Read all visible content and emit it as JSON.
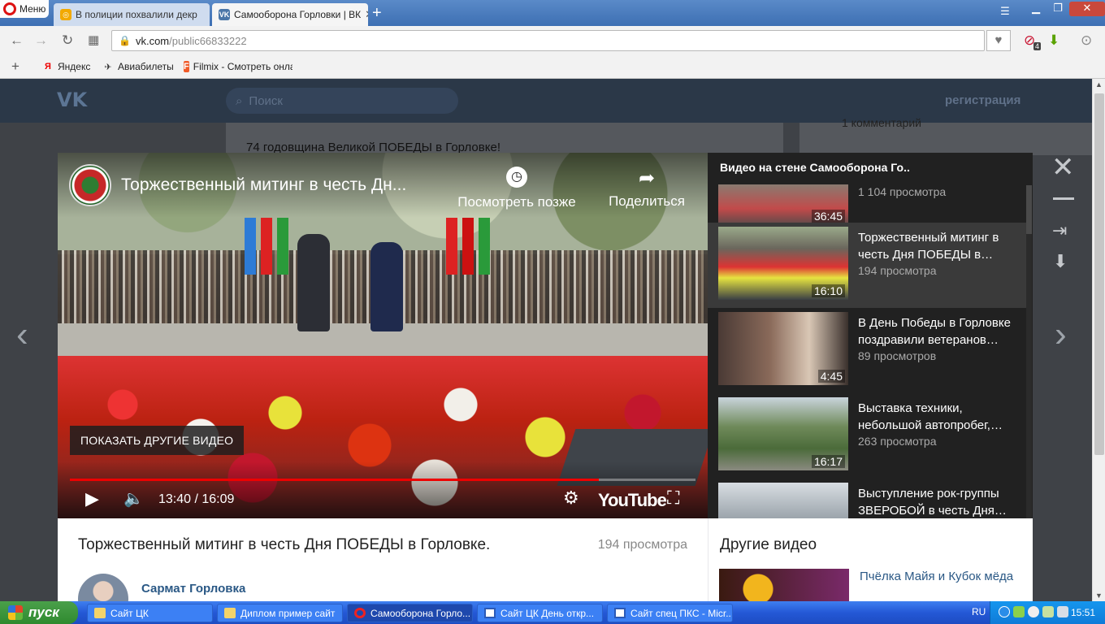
{
  "browser": {
    "menu_label": "Меню",
    "tabs": [
      {
        "title": "В полиции похвалили декр",
        "active": false
      },
      {
        "title": "Самооборона Горловки | ВК",
        "active": true
      }
    ],
    "new_tab_label": "+",
    "url_host": "vk.com",
    "url_path": "/public66833222",
    "bookmarks": [
      {
        "label": "Яндекс",
        "icon": "yandex-icon"
      },
      {
        "label": "Авиабилеты",
        "icon": "plane-icon"
      },
      {
        "label": "Filmix - Смотреть онлай",
        "icon": "filmix-icon"
      }
    ],
    "badge_count": "4"
  },
  "vk": {
    "logo": "VK",
    "search_placeholder": "Поиск",
    "register_label": "регистрация",
    "bg_post_text": "74 годовщина Великой ПОБЕДЫ в Горловке!",
    "bg_side_text": "1 комментарий"
  },
  "player": {
    "title": "Торжественный митинг в честь Дн...",
    "watch_later": "Посмотреть позже",
    "share": "Поделиться",
    "show_more": "ПОКАЗАТЬ ДРУГИЕ ВИДЕО",
    "time": "13:40 / 16:09",
    "progress_fraction": 0.846,
    "youtube_label": "YouTube"
  },
  "playlist": {
    "heading": "Видео на стене Самооборона Го..",
    "items": [
      {
        "title": "",
        "views": "1 104 просмотра",
        "duration": "36:45",
        "current": false
      },
      {
        "title": "Торжественный митинг в честь Дня ПОБЕДЫ в…",
        "views": "194 просмотра",
        "duration": "16:10",
        "current": true
      },
      {
        "title": "В День Победы в Горловке поздравили ветеранов…",
        "views": "89 просмотров",
        "duration": "4:45",
        "current": false
      },
      {
        "title": "Выставка техники, небольшой автопробег,…",
        "views": "263 просмотра",
        "duration": "16:17",
        "current": false
      },
      {
        "title": "Выступление рок-группы ЗВЕРОБОЙ в честь Дня…",
        "views": "",
        "duration": "",
        "current": false
      }
    ]
  },
  "video_info": {
    "title": "Торжественный митинг в честь Дня ПОБЕДЫ в Горловке.",
    "views": "194 просмотра",
    "author": "Сармат Горловка"
  },
  "other_videos": {
    "heading": "Другие видео",
    "items": [
      {
        "title": "Пчёлка Майя и Кубок мёда"
      }
    ]
  },
  "taskbar": {
    "start_label": "пуск",
    "tasks": [
      {
        "label": "Сайт ЦК",
        "icon": "folder-icon",
        "active": false
      },
      {
        "label": "Диплом пример сайт",
        "icon": "folder-icon",
        "active": false
      },
      {
        "label": "Самооборона Горло...",
        "icon": "opera-icon",
        "active": true
      },
      {
        "label": "Сайт ЦК День откр...",
        "icon": "word-icon",
        "active": false
      },
      {
        "label": "Сайт спец ПКС - Micr...",
        "icon": "word-icon",
        "active": false
      }
    ],
    "language": "RU",
    "clock": "15:51"
  }
}
